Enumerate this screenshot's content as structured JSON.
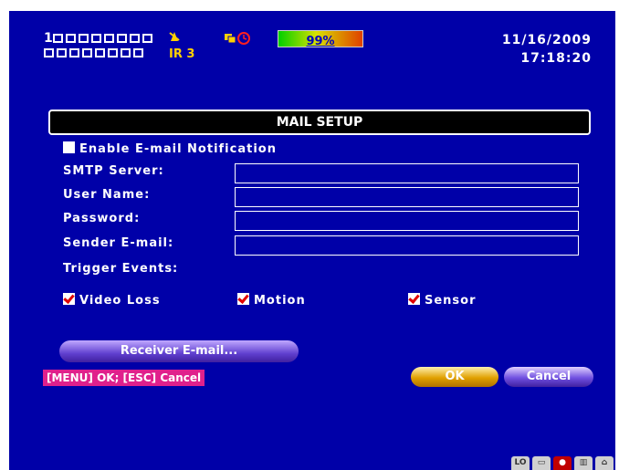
{
  "status": {
    "channel_prefix": "1",
    "ir_label": "IR 3",
    "hdd_usage": "99%",
    "date": "11/16/2009",
    "time": "17:18:20"
  },
  "dialog": {
    "title": "MAIL SETUP",
    "enable_label": "Enable E-mail Notification",
    "enable_checked": false,
    "fields": [
      {
        "label": "SMTP Server:",
        "value": ""
      },
      {
        "label": "User Name:",
        "value": ""
      },
      {
        "label": "Password:",
        "value": ""
      },
      {
        "label": "Sender E-mail:",
        "value": ""
      }
    ],
    "trigger_label": "Trigger Events:",
    "events": [
      {
        "label": "Video Loss",
        "checked": true
      },
      {
        "label": "Motion",
        "checked": true
      },
      {
        "label": "Sensor",
        "checked": true
      }
    ],
    "receiver_button": "Receiver E-mail...",
    "hint": "[MENU] OK; [ESC] Cancel",
    "ok_button": "OK",
    "cancel_button": "Cancel"
  },
  "status_icons": [
    "LO",
    "monitor-icon",
    "record-icon",
    "network-icon",
    "lock-icon"
  ],
  "colors": {
    "background": "#0000a8",
    "hint": "#e0208c",
    "ok": "#e0a000",
    "cancel": "#7050e0"
  }
}
